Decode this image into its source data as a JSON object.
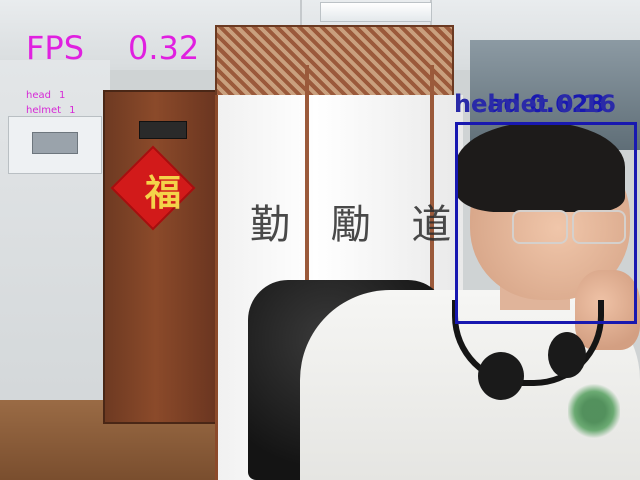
{
  "overlay": {
    "fps_label": "FPS",
    "fps_value": "0.32",
    "counts": [
      {
        "label": "head",
        "value": "1"
      },
      {
        "label": "helmet",
        "value": "1"
      }
    ],
    "detection": {
      "label_head": "head 0.628",
      "label_helmet": "helmet 0.16"
    },
    "colors": {
      "fps_text": "#e020e0",
      "counts_text": "#d62ad6",
      "box": "#1818b0"
    }
  },
  "scene": {
    "door_glyph": "福",
    "screen_calligraphy": "勤 勵 道"
  }
}
